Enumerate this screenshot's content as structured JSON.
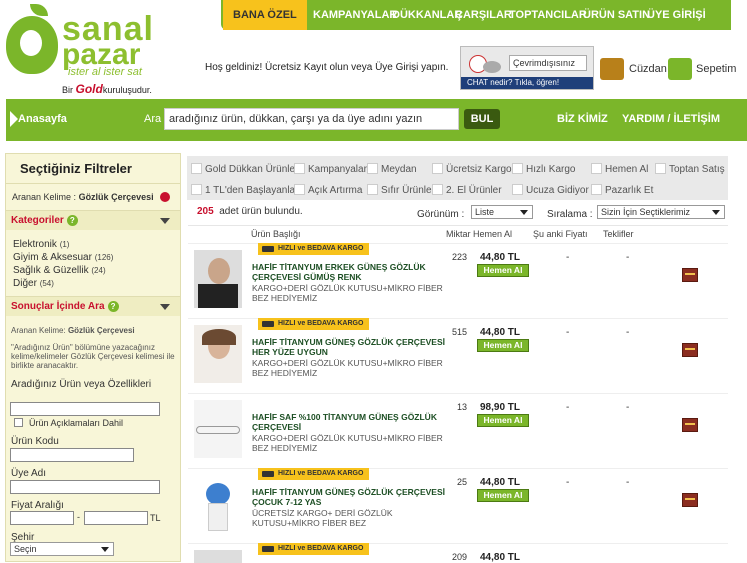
{
  "logo": {
    "line1": "sanal",
    "line2": "pazar",
    "tagline": "ister al ister sat",
    "bir": "Bir",
    "gold": "Gold",
    "kurulus": "kuruluşudur."
  },
  "topnav": [
    "BANA ÖZEL",
    "KAMPANYALAR",
    "DÜKKANLAR",
    "ÇARŞILAR",
    "TOPTANCILAR",
    "ÜRÜN SATIN",
    "ÜYE GİRİŞİ"
  ],
  "welcome": "Hoş geldiniz! Ücretsiz Kayıt olun veya Üye Girişi yapın.",
  "chat": {
    "status": "Çevrimdışısınız",
    "bar": "CHAT nedir?        Tıkla, öğren!"
  },
  "wallet": "Cüzdan",
  "cart": "Sepetim",
  "search": {
    "home": "Anasayfa",
    "label": "Ara",
    "value": "aradığınız ürün, dükkan, çarşı ya da üye adını yazın",
    "button": "BUL",
    "about": "BİZ KİMİZ",
    "help": "YARDIM / İLETİŞİM"
  },
  "filters": {
    "title": "Seçtiğiniz Filtreler",
    "keyword_label": "Aranan Kelime :",
    "keyword_value": "Gözlük Çerçevesi",
    "categories_title": "Kategoriler",
    "categories": [
      {
        "name": "Elektronik",
        "count": "(1)"
      },
      {
        "name": "Giyim & Aksesuar",
        "count": "(126)"
      },
      {
        "name": "Sağlık & Güzellik",
        "count": "(24)"
      },
      {
        "name": "Diğer",
        "count": "(54)"
      }
    ],
    "within_title": "Sonuçlar İçinde Ara",
    "within_kw_label": "Aranan Kelime:",
    "within_kw_value": "Gözlük Çerçevesi",
    "within_note": "\"Aradığınız Ürün\" bölümüne yazacağınız kelime/kelimeler Gözlük Çerçevesi kelimesi ile birlikte aranacaktır.",
    "features_label": "Aradığınız Ürün veya Özellikleri",
    "desc_include": "Ürün Açıklamaları Dahil",
    "code_label": "Ürün Kodu",
    "member_label": "Üye Adı",
    "price_label": "Fiyat Aralığı",
    "currency": "TL",
    "city_label": "Şehir",
    "city_value": "Seçin"
  },
  "quick_filters": [
    "Gold Dükkan Ürünleri",
    "Kampanyalar",
    "Meydan",
    "Ücretsiz Kargo",
    "Hızlı Kargo",
    "Hemen Al",
    "Toptan Satış",
    "1 TL'den Başlayanlar",
    "Açık Artırma",
    "Sıfır Ürünler",
    "2. El Ürünler",
    "Ucuza Gidiyor",
    "Pazarlık Et"
  ],
  "summary": {
    "count": "205",
    "text": "adet ürün bulundu.",
    "view_label": "Görünüm :",
    "view_value": "Liste",
    "sort_label": "Sıralama :",
    "sort_value": "Sizin İçin Seçtiklerimiz"
  },
  "columns": [
    "Ürün Başlığı",
    "Miktar",
    "Hemen Al",
    "Şu anki Fiyatı",
    "Teklifler"
  ],
  "products": [
    {
      "badge": "HIZLI ve BEDAVA KARGO",
      "title": "HAFİF TİTANYUM ERKEK GÜNEŞ GÖZLÜK ÇERÇEVESİ GÜMÜŞ RENK",
      "desc": "KARGO+DERİ GÖZLÜK KUTUSU+MİKRO FİBER BEZ HEDİYEMİZ",
      "qty": "223",
      "price": "44,80 TL",
      "buy": "Hemen Al",
      "current": "-",
      "offers": "-"
    },
    {
      "badge": "HIZLI ve BEDAVA KARGO",
      "title": "HAFİF TİTANYUM GÜNEŞ GÖZLÜK ÇERÇEVESİ HER YÜZE UYGUN",
      "desc": "KARGO+DERİ GÖZLÜK KUTUSU+MİKRO FİBER BEZ HEDİYEMİZ",
      "qty": "515",
      "price": "44,80 TL",
      "buy": "Hemen Al",
      "current": "-",
      "offers": "-"
    },
    {
      "badge": "",
      "title": "HAFİF SAF %100 TİTANYUM GÜNEŞ GÖZLÜK ÇERÇEVESİ",
      "desc": "KARGO+DERİ GÖZLÜK KUTUSU+MİKRO FİBER BEZ HEDİYEMİZ",
      "qty": "13",
      "price": "98,90 TL",
      "buy": "Hemen Al",
      "current": "-",
      "offers": "-"
    },
    {
      "badge": "HIZLI ve BEDAVA KARGO",
      "title": "HAFİF TİTANYUM GÜNEŞ GÖZLÜK ÇERÇEVESİ ÇOCUK 7-12 YAS",
      "desc": "ÜCRETSİZ KARGO+ DERİ GÖZLÜK KUTUSU+MİKRO FİBER BEZ",
      "qty": "25",
      "price": "44,80 TL",
      "buy": "Hemen Al",
      "current": "-",
      "offers": "-"
    },
    {
      "badge": "HIZLI ve BEDAVA KARGO",
      "title": "",
      "desc": "",
      "qty": "209",
      "price": "44,80 TL",
      "buy": "",
      "current": "",
      "offers": ""
    }
  ]
}
